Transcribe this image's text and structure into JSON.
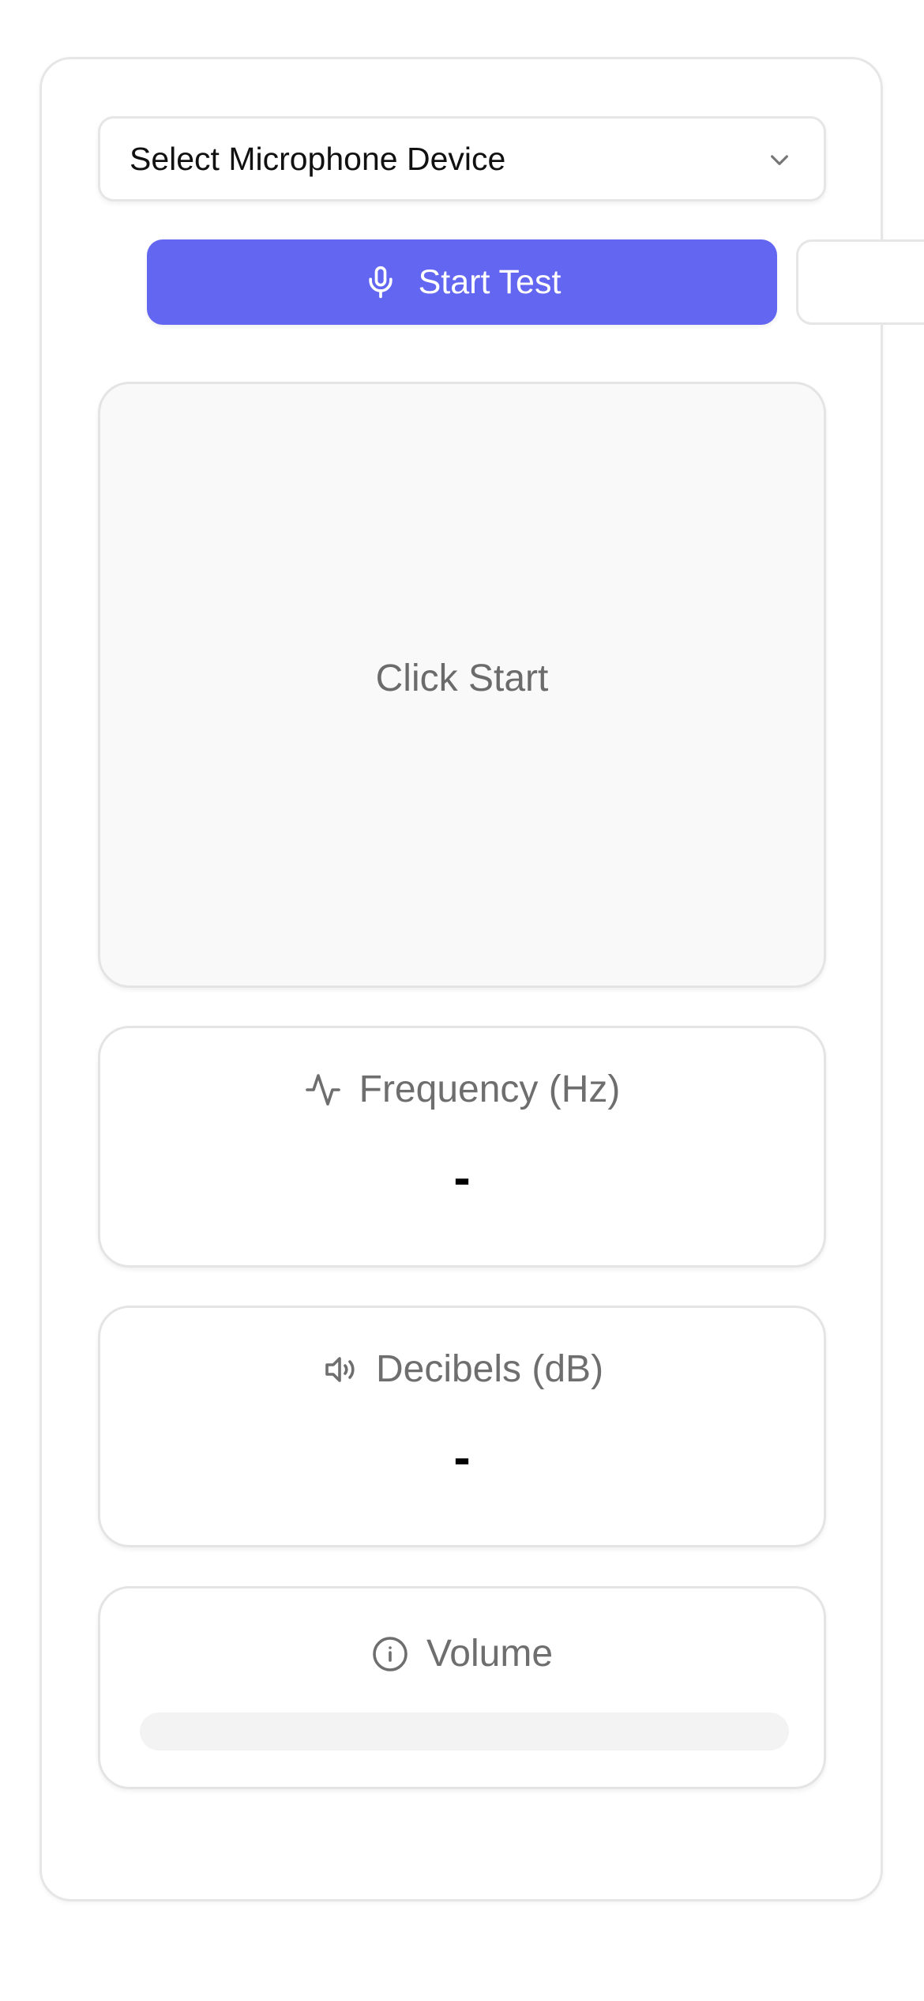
{
  "device_select": {
    "label": "Select Microphone Device",
    "icon": "chevron-down-icon"
  },
  "start_button": {
    "label": "Start Test",
    "icon": "microphone-icon",
    "color": "#6366f1"
  },
  "visualizer": {
    "message": "Click Start"
  },
  "stats": {
    "frequency": {
      "title": "Frequency (Hz)",
      "icon": "activity-icon",
      "value": "-"
    },
    "decibels": {
      "title": "Decibels (dB)",
      "icon": "speaker-icon",
      "value": "-"
    },
    "volume": {
      "title": "Volume",
      "icon": "info-icon",
      "level": 0
    }
  }
}
